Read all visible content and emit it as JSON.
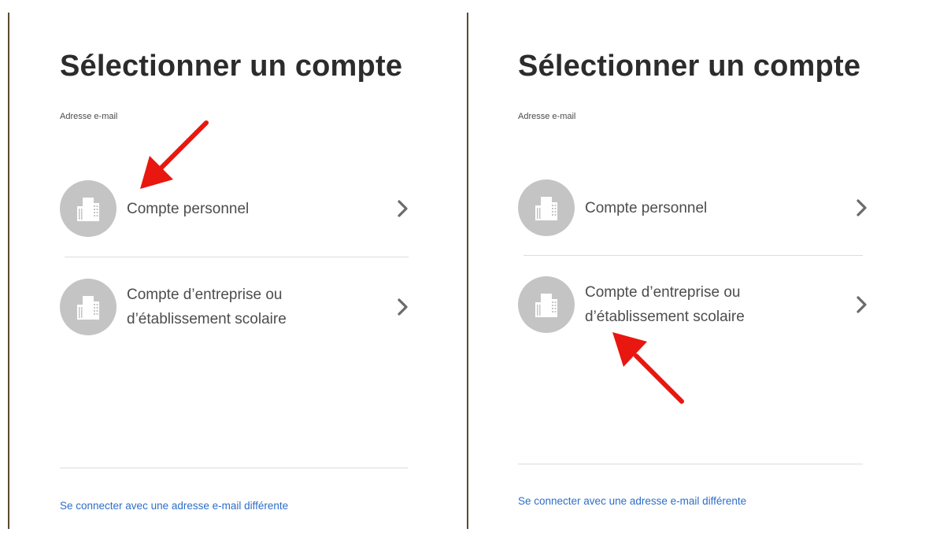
{
  "panels": [
    {
      "title": "Sélectionner un compte",
      "email_label": "Adresse e-mail",
      "accounts": [
        {
          "icon": "building-icon",
          "label_line1": "Compte personnel",
          "label_line2": ""
        },
        {
          "icon": "building-icon",
          "label_line1": "Compte d’entreprise ou",
          "label_line2": "d’établissement scolaire"
        }
      ],
      "alt_link": "Se connecter avec une adresse e-mail différente"
    },
    {
      "title": "Sélectionner un compte",
      "email_label": "Adresse e-mail",
      "accounts": [
        {
          "icon": "building-icon",
          "label_line1": "Compte personnel",
          "label_line2": ""
        },
        {
          "icon": "building-icon",
          "label_line1": "Compte d’entreprise ou",
          "label_line2": "d’établissement scolaire"
        }
      ],
      "alt_link": "Se connecter avec une adresse e-mail différente"
    }
  ],
  "colors": {
    "arrow": "#e8170f",
    "avatar_bg": "#c4c4c4",
    "link": "#2d6ec9",
    "chevron": "#6b6b6b"
  }
}
